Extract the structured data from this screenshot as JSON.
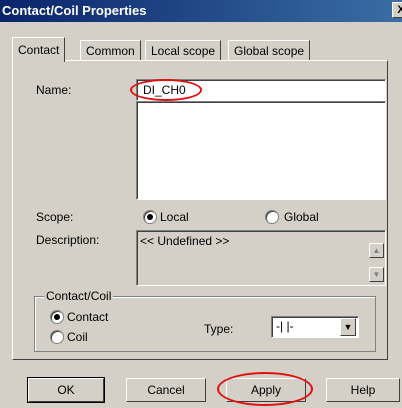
{
  "window": {
    "title": "Contact/Coil Properties",
    "close_glyph": "X"
  },
  "tabs": [
    {
      "label": "Contact",
      "active": true
    },
    {
      "label": "Common",
      "active": false
    },
    {
      "label": "Local scope",
      "active": false
    },
    {
      "label": "Global scope",
      "active": false
    }
  ],
  "form": {
    "name_label": "Name:",
    "name_value": "DI_CH0",
    "scope_label": "Scope:",
    "scope_local": "Local",
    "scope_global": "Global",
    "scope_selected": "Local",
    "description_label": "Description:",
    "description_value": "<< Undefined >>"
  },
  "group": {
    "legend": "Contact/Coil",
    "contact_label": "Contact",
    "coil_label": "Coil",
    "selected": "Contact",
    "type_label": "Type:",
    "type_value": "-| |-"
  },
  "buttons": {
    "ok": "OK",
    "cancel": "Cancel",
    "apply": "Apply",
    "help": "Help"
  },
  "colors": {
    "title_bar": "#0a246a",
    "dialog_bg": "#d4d0c8",
    "highlight": "#e01010"
  },
  "icons": {
    "close": "close-icon",
    "scroll_up": "arrow-up-icon",
    "scroll_down": "arrow-down-icon",
    "dropdown": "chevron-down-icon"
  }
}
